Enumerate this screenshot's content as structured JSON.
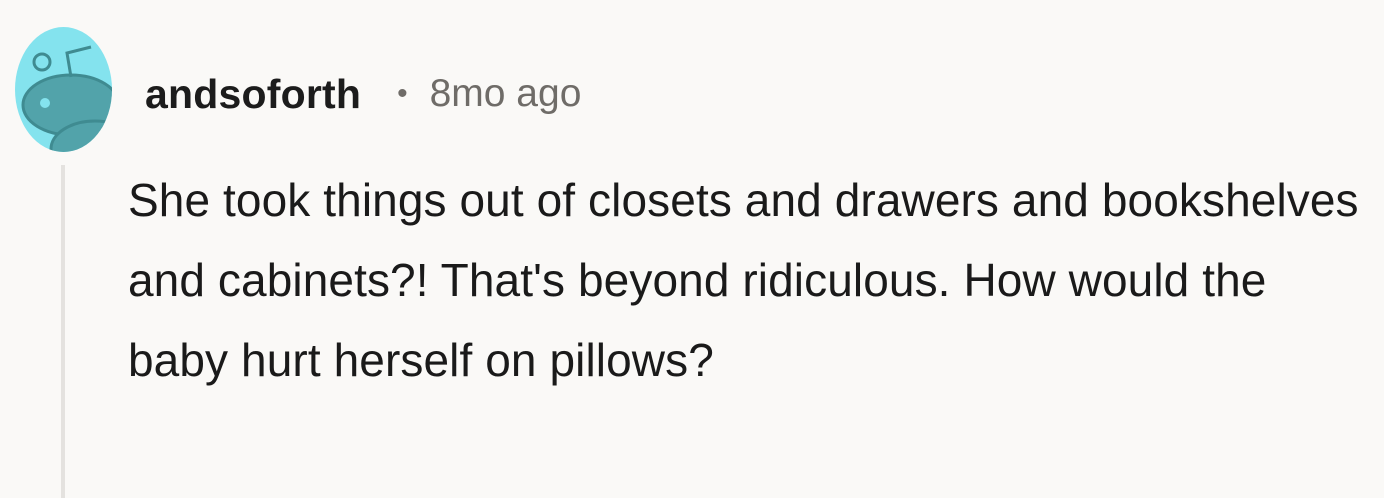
{
  "comment": {
    "avatar_icon": "reddit-snoo-avatar-icon",
    "username": "andsoforth",
    "separator": "•",
    "timestamp": "8mo ago",
    "body": "She took things out of closets and drawers and bookshelves and cabinets?! That's beyond ridiculous. How would the baby hurt herself on pillows?"
  },
  "colors": {
    "background": "#faf9f7",
    "avatar_bg": "#84e3ee",
    "avatar_figure": "#52a3aa",
    "thread_line": "#e4e2df",
    "username": "#1c1c1c",
    "meta_text": "#6f6c68",
    "body_text": "#1a1a1a"
  }
}
